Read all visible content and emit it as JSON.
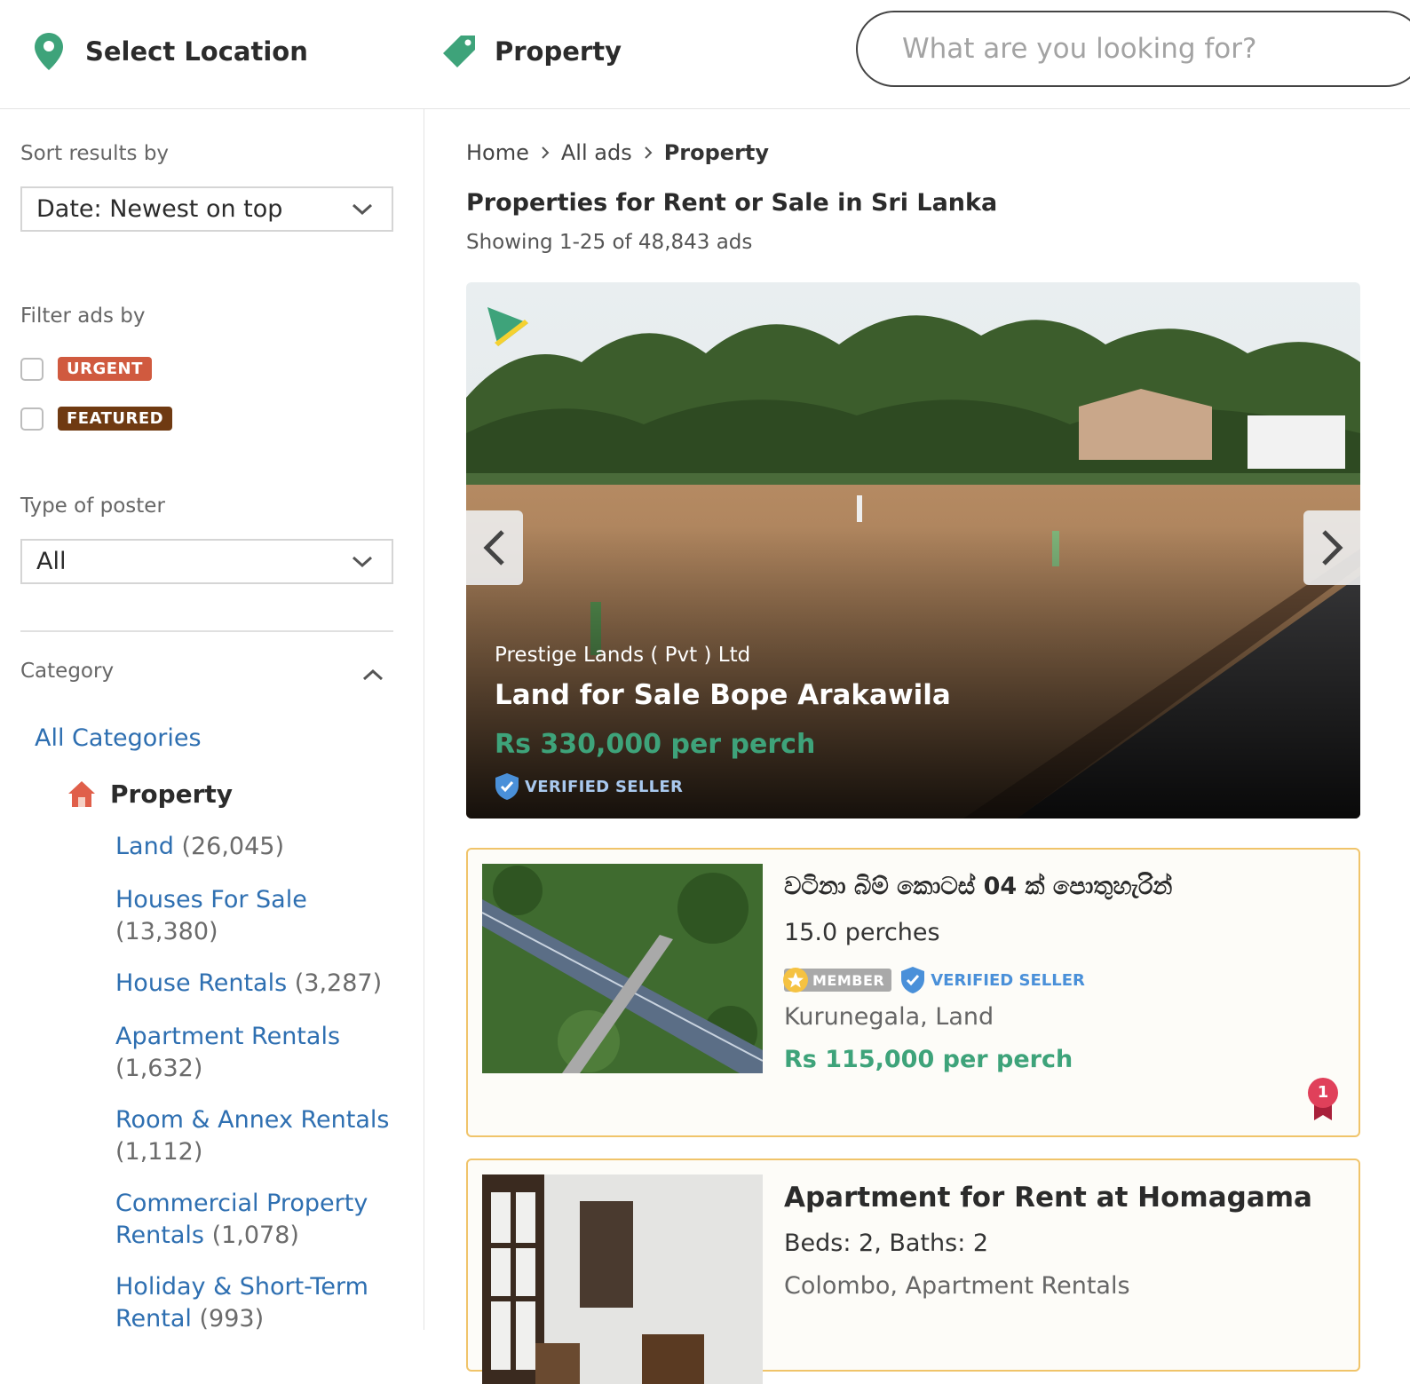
{
  "header": {
    "location_label": "Select Location",
    "category_label": "Property",
    "search_placeholder": "What are you looking for?"
  },
  "sidebar": {
    "sort_label": "Sort results by",
    "sort_value": "Date: Newest on top",
    "filter_label": "Filter ads by",
    "filters": [
      "URGENT",
      "FEATURED"
    ],
    "poster_label": "Type of poster",
    "poster_value": "All",
    "category_label": "Category",
    "all_categories": "All Categories",
    "current_category": "Property",
    "subcategories": [
      {
        "name": "Land",
        "count": "(26,045)"
      },
      {
        "name": "Houses For Sale",
        "count": "(13,380)"
      },
      {
        "name": "House Rentals",
        "count": "(3,287)"
      },
      {
        "name": "Apartment Rentals",
        "count": "(1,632)"
      },
      {
        "name": "Room & Annex Rentals",
        "count": "(1,112)"
      },
      {
        "name": "Commercial Property Rentals",
        "count": "(1,078)"
      },
      {
        "name": "Holiday & Short-Term Rental",
        "count": "(993)"
      }
    ]
  },
  "main": {
    "breadcrumbs": [
      "Home",
      "All ads",
      "Property"
    ],
    "title": "Properties for Rent or Sale in Sri Lanka",
    "showing": "Showing 1-25 of 48,843 ads",
    "hero": {
      "seller": "Prestige Lands ( Pvt ) Ltd",
      "title": "Land for Sale Bope Arakawila",
      "price": "Rs 330,000 per perch",
      "verified": "VERIFIED SELLER"
    },
    "listings": [
      {
        "title": "වටිනා බිම් කොටස් 04 ක් පොතුහැරින්",
        "detail": "15.0 perches",
        "member": "MEMBER",
        "verified": "VERIFIED SELLER",
        "location": "Kurunegala, Land",
        "price": "Rs 115,000 per perch",
        "rank": "1"
      },
      {
        "title": "Apartment for Rent at Homagama",
        "detail": "Beds: 2, Baths: 2",
        "location": "Colombo, Apartment Rentals"
      }
    ]
  },
  "colors": {
    "brand_green": "#3ea37a",
    "link_blue": "#2e6fb1",
    "urgent": "#d05a3f",
    "featured": "#6f3a12",
    "card_border": "#f0c46a"
  }
}
